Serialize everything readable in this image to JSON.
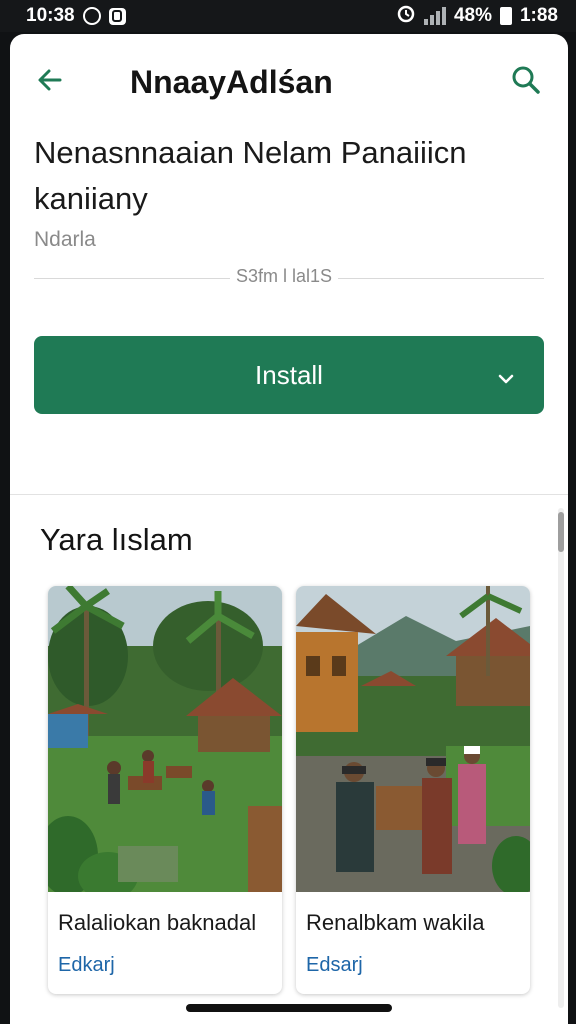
{
  "status_bar": {
    "time_left": "10:38",
    "battery_percent": "48%",
    "time_right": "1:88"
  },
  "app_bar": {
    "title": "NnaayAdlśan",
    "back_icon": "arrow-left-icon",
    "search_icon": "search-icon"
  },
  "app": {
    "headline": "Nenasnnaaian Nelam Panaiiicn kaniiany",
    "developer": "Ndarla",
    "size": "S3fm l lal1S",
    "install_label": "Install"
  },
  "section": {
    "title": "Yara lıslam",
    "cards": [
      {
        "title": "Ralaliokan baknadal",
        "subtitle": "Edkarj"
      },
      {
        "title": "Renalbkam wakila",
        "subtitle": "Edsarj"
      }
    ]
  },
  "colors": {
    "accent": "#1f7a55",
    "link": "#1e66a8"
  }
}
